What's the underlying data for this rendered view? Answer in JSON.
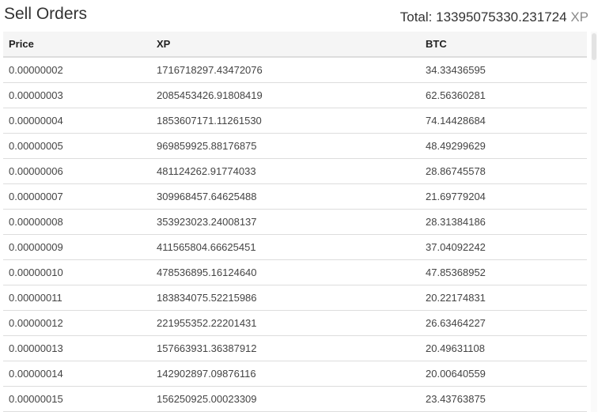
{
  "header": {
    "title": "Sell Orders",
    "total_label": "Total:",
    "total_value": "13395075330.231724",
    "total_unit": "XP"
  },
  "table": {
    "columns": [
      "Price",
      "XP",
      "BTC"
    ],
    "rows": [
      [
        "0.00000002",
        "1716718297.43472076",
        "34.33436595"
      ],
      [
        "0.00000003",
        "2085453426.91808419",
        "62.56360281"
      ],
      [
        "0.00000004",
        "1853607171.11261530",
        "74.14428684"
      ],
      [
        "0.00000005",
        "969859925.88176875",
        "48.49299629"
      ],
      [
        "0.00000006",
        "481124262.91774033",
        "28.86745578"
      ],
      [
        "0.00000007",
        "309968457.64625488",
        "21.69779204"
      ],
      [
        "0.00000008",
        "353923023.24008137",
        "28.31384186"
      ],
      [
        "0.00000009",
        "411565804.66625451",
        "37.04092242"
      ],
      [
        "0.00000010",
        "478536895.16124640",
        "47.85368952"
      ],
      [
        "0.00000011",
        "183834075.52215986",
        "20.22174831"
      ],
      [
        "0.00000012",
        "221955352.22201431",
        "26.63464227"
      ],
      [
        "0.00000013",
        "157663931.36387912",
        "20.49631108"
      ],
      [
        "0.00000014",
        "142902897.09876116",
        "20.00640559"
      ],
      [
        "0.00000015",
        "156250925.00023309",
        "23.43763875"
      ]
    ]
  }
}
